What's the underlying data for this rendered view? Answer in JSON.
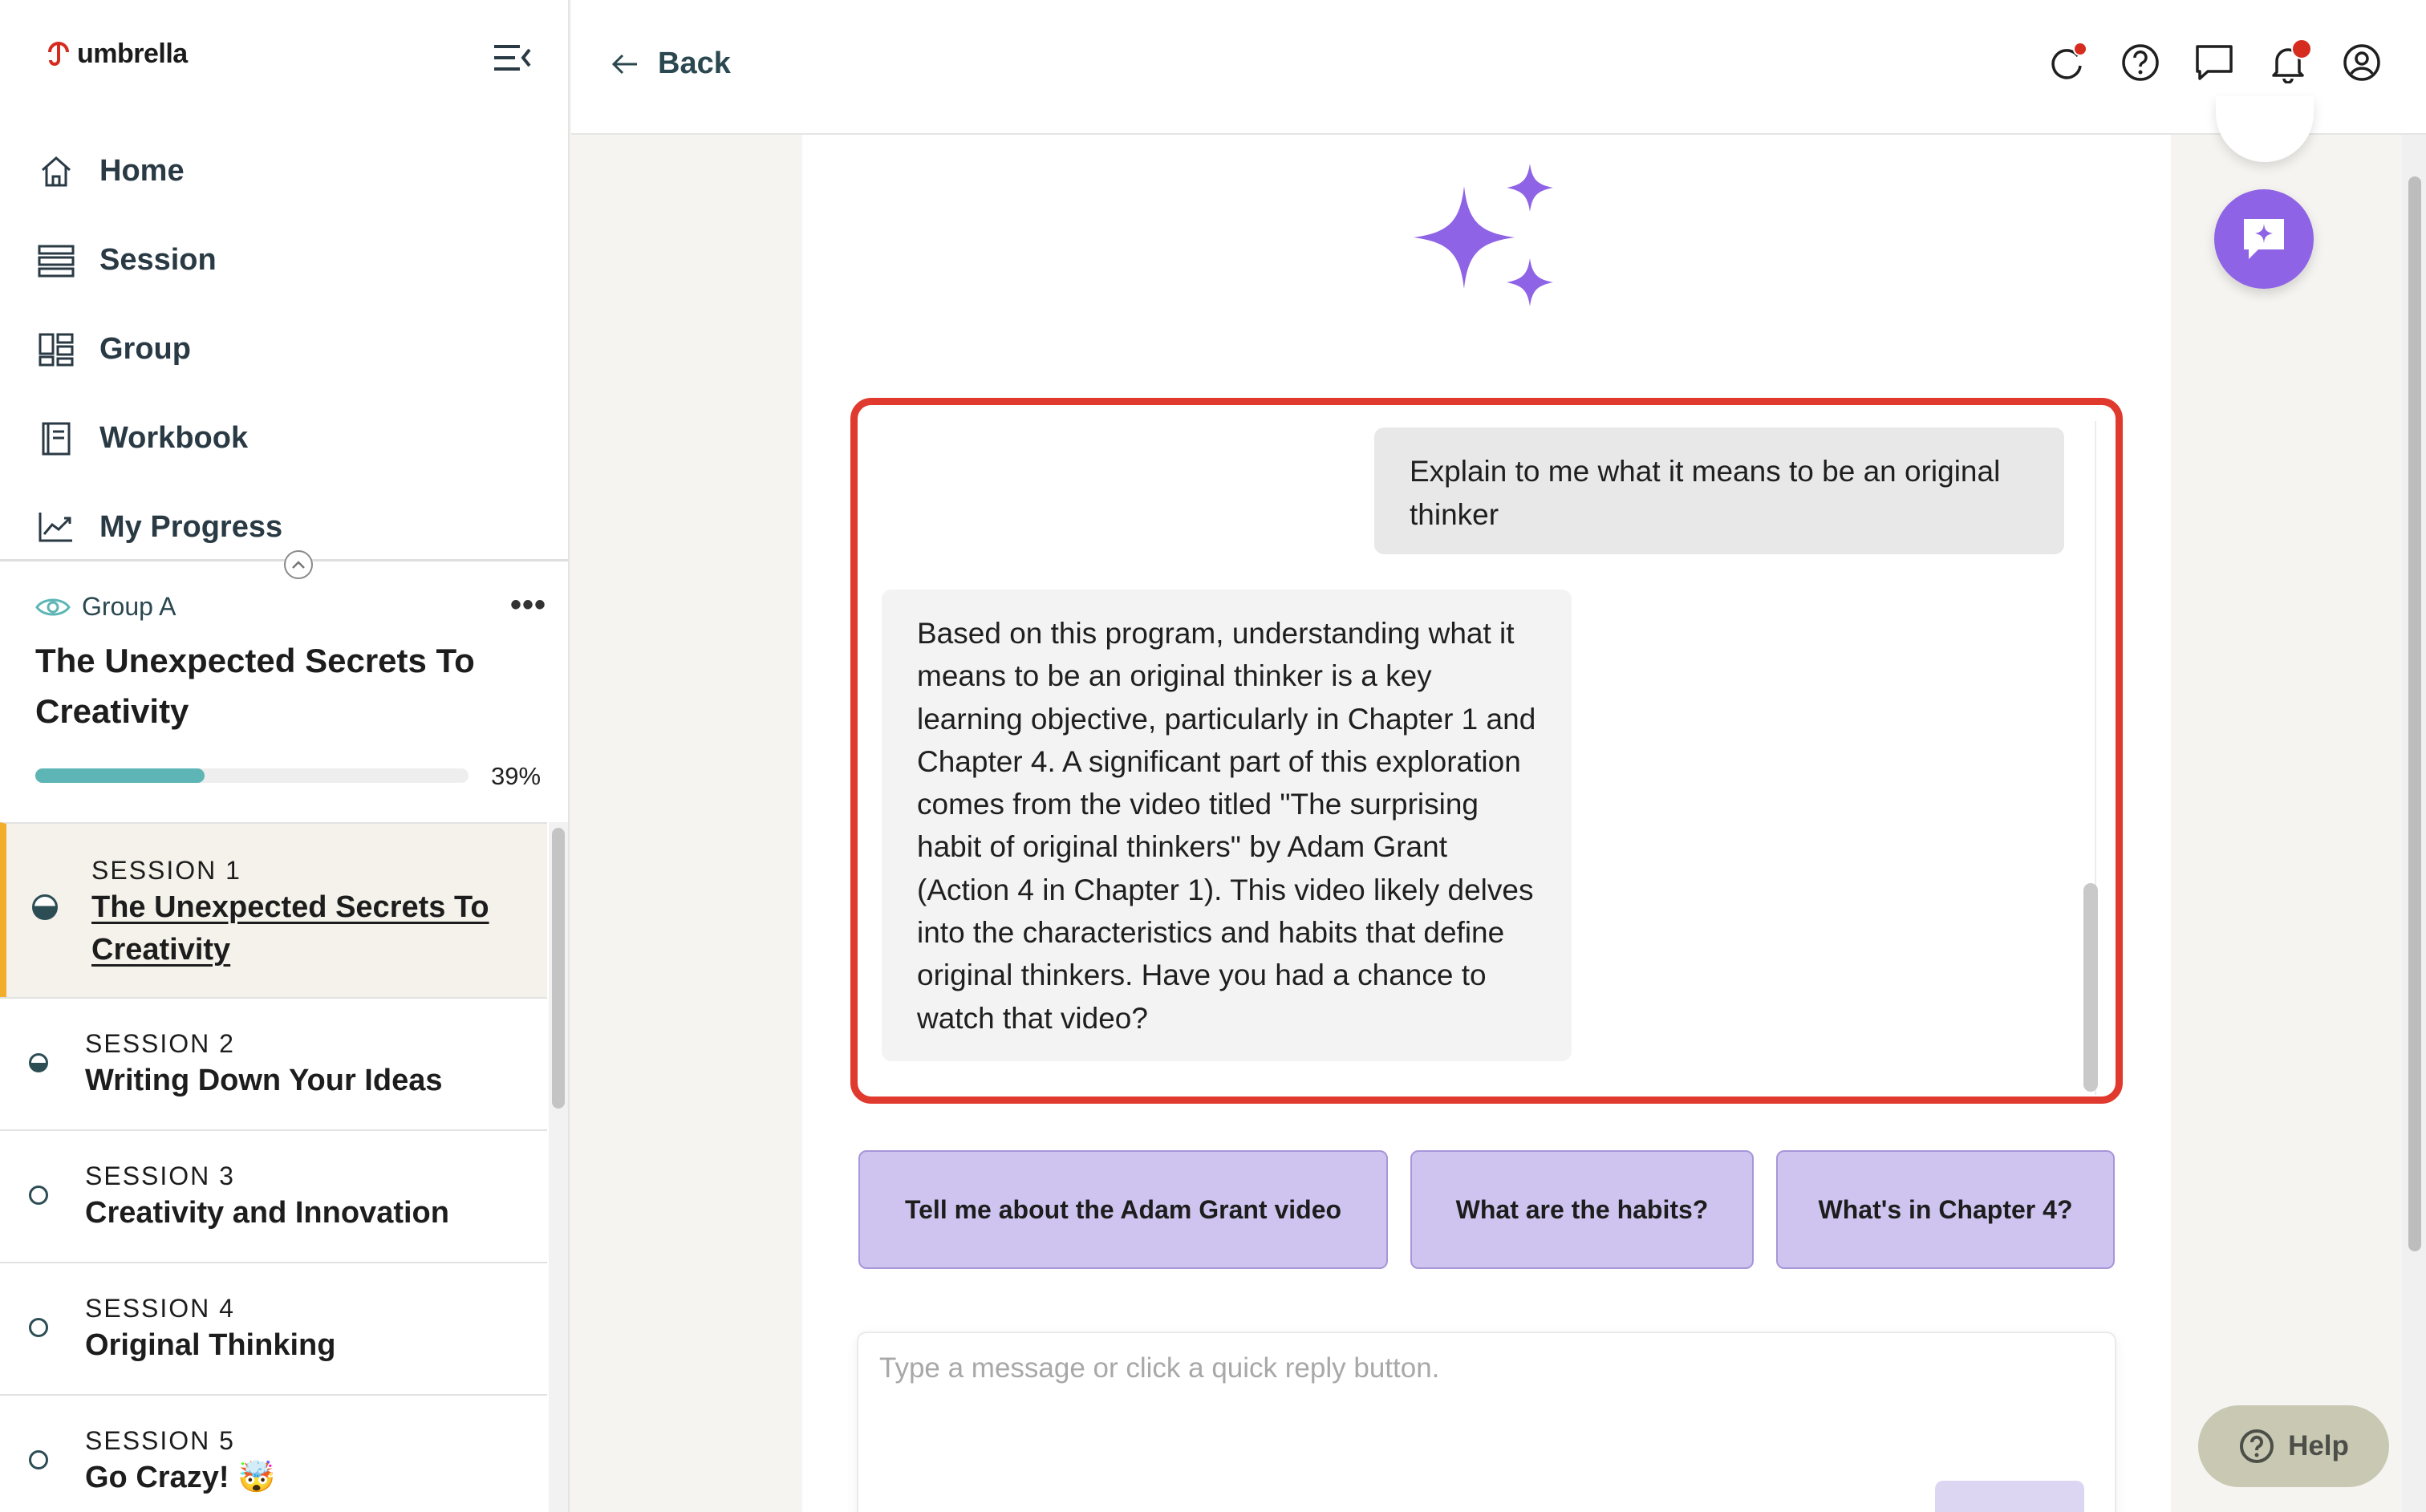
{
  "brand": {
    "name": "umbrella"
  },
  "nav": {
    "items": [
      {
        "label": "Home",
        "icon": "home-icon"
      },
      {
        "label": "Session",
        "icon": "session-list-icon"
      },
      {
        "label": "Group",
        "icon": "group-icon"
      },
      {
        "label": "Workbook",
        "icon": "workbook-icon"
      },
      {
        "label": "My Progress",
        "icon": "progress-chart-icon"
      }
    ]
  },
  "group": {
    "label": "Group A",
    "course_title": "The Unexpected Secrets To Creativity",
    "progress": 0.39,
    "progress_label": "39%"
  },
  "sessions": [
    {
      "num": "SESSION 1",
      "title": "The Unexpected Secrets To Creativity",
      "state": "active"
    },
    {
      "num": "SESSION 2",
      "title": "Writing Down Your Ideas",
      "state": "started"
    },
    {
      "num": "SESSION 3",
      "title": "Creativity and Innovation",
      "state": "todo"
    },
    {
      "num": "SESSION 4",
      "title": "Original Thinking",
      "state": "todo"
    },
    {
      "num": "SESSION 5",
      "title": "Go Crazy! 🤯",
      "state": "todo"
    }
  ],
  "topbar": {
    "back_label": "Back"
  },
  "chat": {
    "user_message": "Explain to me what it means to be an original thinker",
    "bot_message": "Based on this program, understanding what it means to be an original thinker is a key learning objective, particularly in Chapter 1 and Chapter 4. A significant part of this exploration comes from the video titled \"The surprising habit of original thinkers\" by Adam Grant (Action 4 in Chapter 1). This video likely delves into the characteristics and habits that define original thinkers. Have you had a chance to watch that video?",
    "quick_replies": [
      "Tell me about the Adam Grant video",
      "What are the habits?",
      "What's in Chapter 4?"
    ],
    "input_placeholder": "Type a message or click a quick reply button."
  },
  "help": {
    "label": "Help"
  },
  "colors": {
    "accent_purple": "#8f63e6",
    "highlight_red": "#e03a2e",
    "progress_teal": "#5db5b5",
    "active_session_bar": "#f2ae2b",
    "notification_red": "#d62b1f"
  }
}
